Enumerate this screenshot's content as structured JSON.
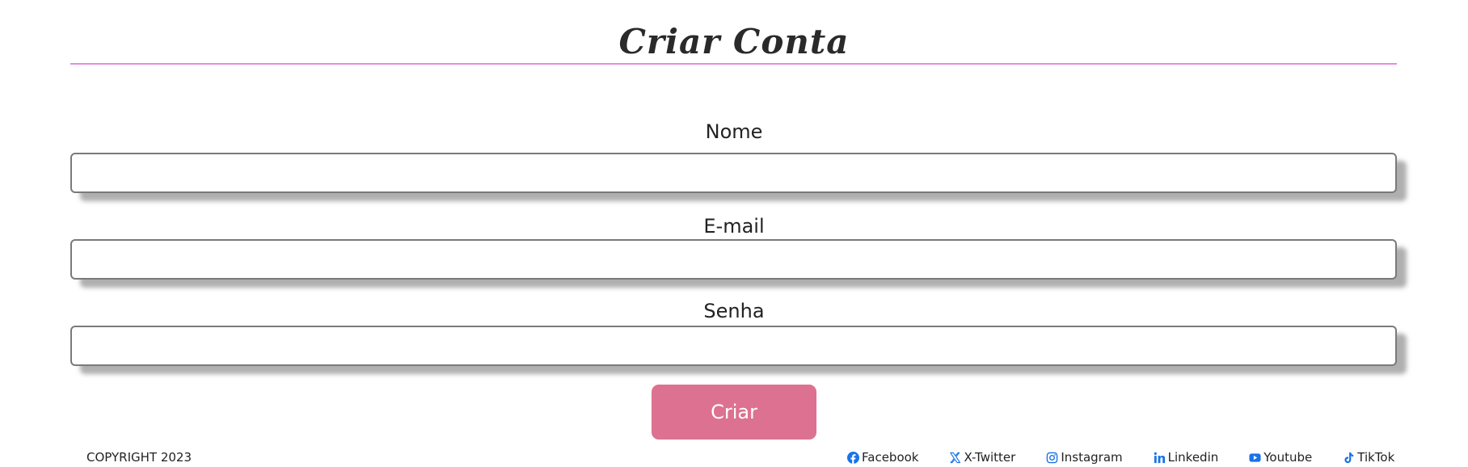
{
  "header": {
    "title": "Criar Conta"
  },
  "form": {
    "fields": [
      {
        "label": "Nome",
        "value": "",
        "placeholder": ""
      },
      {
        "label": "E-mail",
        "value": "",
        "placeholder": ""
      },
      {
        "label": "Senha",
        "value": "",
        "placeholder": ""
      }
    ],
    "submit_label": "Criar"
  },
  "footer": {
    "copyright": "COPYRIGHT 2023",
    "social": [
      {
        "label": "Facebook",
        "icon": "facebook-icon"
      },
      {
        "label": "X-Twitter",
        "icon": "x-twitter-icon"
      },
      {
        "label": "Instagram",
        "icon": "instagram-icon"
      },
      {
        "label": "Linkedin",
        "icon": "linkedin-icon"
      },
      {
        "label": "Youtube",
        "icon": "youtube-icon"
      },
      {
        "label": "TikTok",
        "icon": "tiktok-icon"
      }
    ]
  },
  "colors": {
    "accent_rule": "#e58be3",
    "button": "#dd7191",
    "social_icon": "#1a73e8"
  }
}
